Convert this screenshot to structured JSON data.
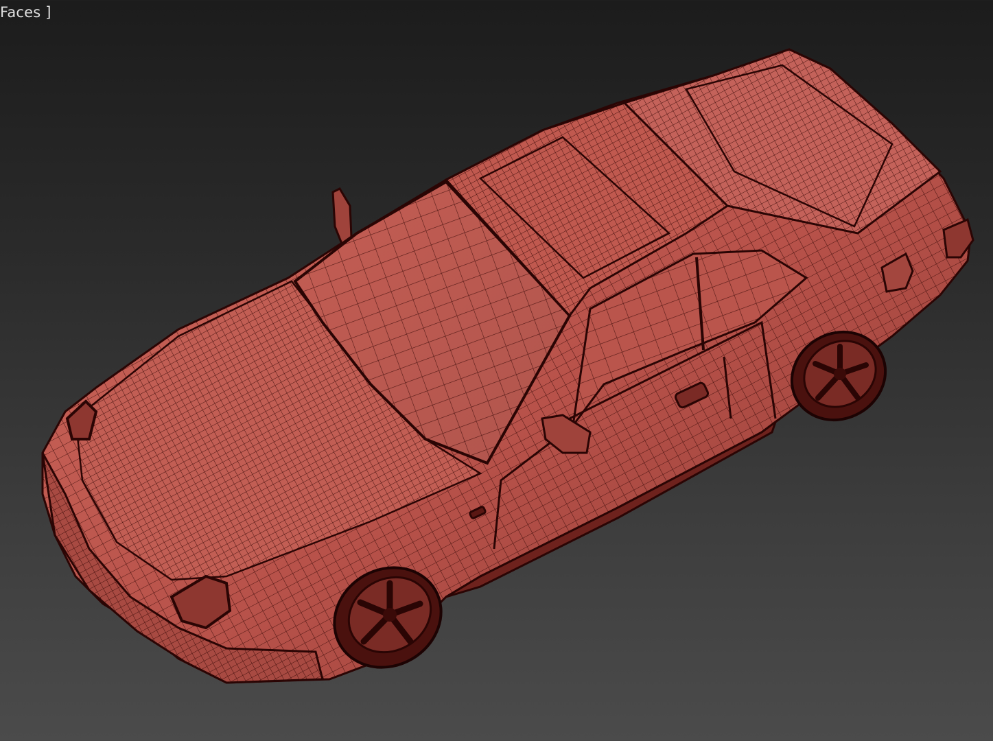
{
  "viewport": {
    "label": "Faces ]",
    "shading_mode": "faces",
    "model": {
      "mesh_color": "#b8524a",
      "wire_color": "#3a0a08",
      "background_top": "#1c1c1c",
      "background_bottom": "#4b4b4b"
    }
  }
}
